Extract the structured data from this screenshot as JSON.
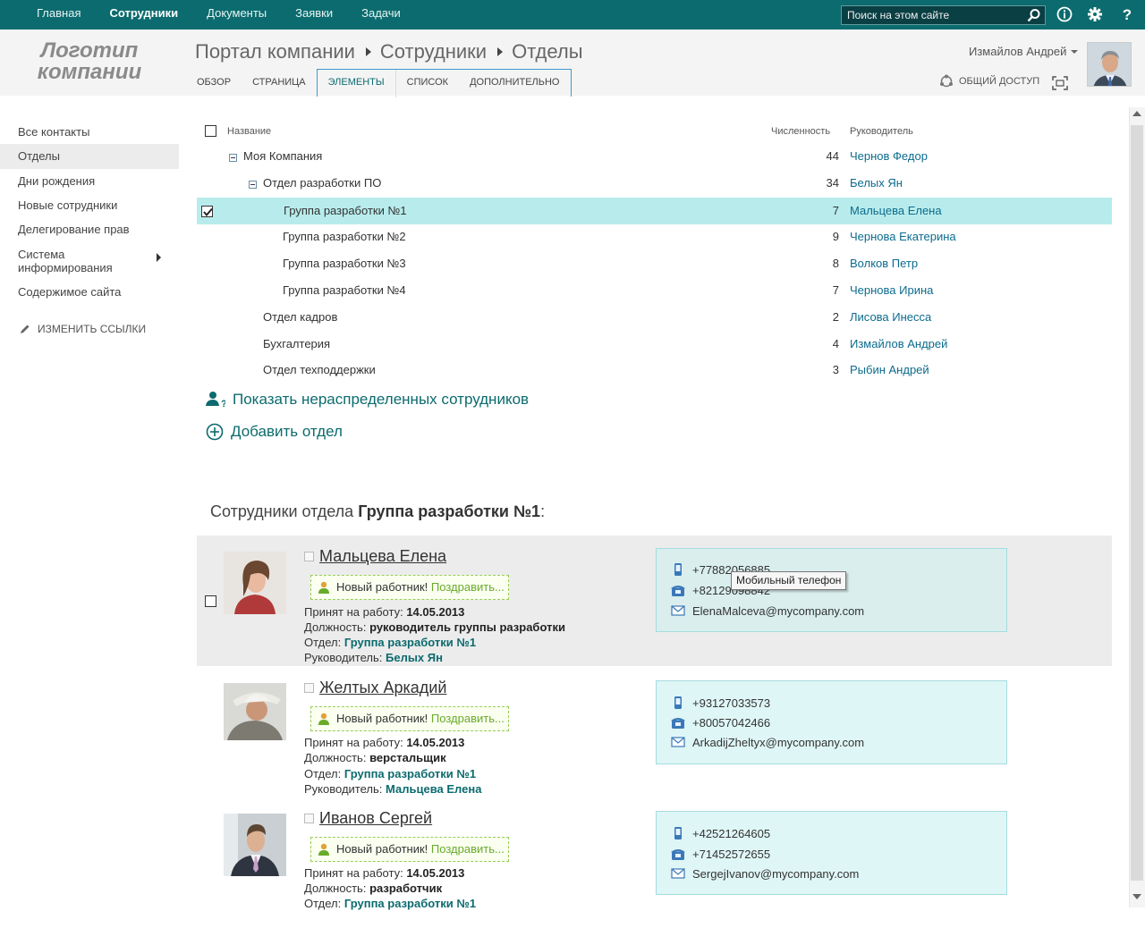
{
  "topnav": {
    "items": [
      {
        "label": "Главная",
        "active": false
      },
      {
        "label": "Сотрудники",
        "active": true
      },
      {
        "label": "Документы",
        "active": false
      },
      {
        "label": "Заявки",
        "active": false
      },
      {
        "label": "Задачи",
        "active": false
      }
    ],
    "search_placeholder": "Поиск на этом сайте"
  },
  "colors": {
    "topbar": "#0c6b6e",
    "link": "#0c6b8e",
    "selected_row": "#b8ecec",
    "new_worker_accent": "#6aaa2a"
  },
  "header": {
    "logo_line1": "Логотип",
    "logo_line2": "компании",
    "breadcrumb": [
      "Портал компании",
      "Сотрудники",
      "Отделы"
    ],
    "ribbon_tabs": [
      "ОБЗОР",
      "СТРАНИЦА",
      "ЭЛЕМЕНТЫ",
      "СПИСОК",
      "ДОПОЛНИТЕЛЬНО"
    ],
    "user_name": "Измайлов Андрей",
    "share_label": "ОБЩИЙ ДОСТУП"
  },
  "sidebar": {
    "items": [
      {
        "label": "Все контакты"
      },
      {
        "label": "Отделы"
      },
      {
        "label": "Дни рождения"
      },
      {
        "label": "Новые сотрудники"
      },
      {
        "label": "Делегирование прав"
      },
      {
        "label": "Система информирования"
      },
      {
        "label": "Содержимое сайта"
      }
    ],
    "edit_links": "ИЗМЕНИТЬ ССЫЛКИ"
  },
  "departments": {
    "columns": {
      "name": "Название",
      "count": "Численность",
      "manager": "Руководитель"
    },
    "rows": [
      {
        "name": "Моя Компания",
        "count": "44",
        "manager": "Чернов Федор"
      },
      {
        "name": "Отдел разработки ПО",
        "count": "34",
        "manager": "Белых Ян"
      },
      {
        "name": "Группа разработки №1",
        "count": "7",
        "manager": "Мальцева Елена"
      },
      {
        "name": "Группа разработки №2",
        "count": "9",
        "manager": "Чернова Екатерина"
      },
      {
        "name": "Группа разработки №3",
        "count": "8",
        "manager": "Волков Петр"
      },
      {
        "name": "Группа разработки №4",
        "count": "7",
        "manager": "Чернова Ирина"
      },
      {
        "name": "Отдел кадров",
        "count": "2",
        "manager": "Лисова Инесса"
      },
      {
        "name": "Бухгалтерия",
        "count": "4",
        "manager": "Измайлов Андрей"
      },
      {
        "name": "Отдел техподдержки",
        "count": "3",
        "manager": "Рыбин Андрей"
      }
    ],
    "show_unassigned": "Показать нераспределенных сотрудников",
    "add_department": "Добавить отдел"
  },
  "employees_section": {
    "title_prefix": "Сотрудники отдела",
    "title_dept": "Группа разработки №1",
    "title_suffix": ":",
    "new_worker_label": "Новый работник!",
    "congratulate_label": "Поздравить...",
    "hired_label": "Принят на работу:",
    "position_label": "Должность:",
    "dept_label": "Отдел:",
    "manager_label": "Руководитель:",
    "tooltip": "Мобильный телефон"
  },
  "employees": [
    {
      "name": "Мальцева Елена",
      "hired": "14.05.2013",
      "position": "руководитель группы разработки",
      "department": "Группа разработки №1",
      "manager": "Белых Ян",
      "mobile": "+77882056885",
      "phone": "+82129098842",
      "email": "ElenaMalceva@mycompany.com"
    },
    {
      "name": "Желтых Аркадий",
      "hired": "14.05.2013",
      "position": "верстальщик",
      "department": "Группа разработки №1",
      "manager": "Мальцева Елена",
      "mobile": "+93127033573",
      "phone": "+80057042466",
      "email": "ArkadijZheltyx@mycompany.com"
    },
    {
      "name": "Иванов Сергей",
      "hired": "14.05.2013",
      "position": "разработчик",
      "department": "Группа разработки №1",
      "manager": "",
      "mobile": "+42521264605",
      "phone": "+71452572655",
      "email": "SergejIvanov@mycompany.com"
    }
  ]
}
